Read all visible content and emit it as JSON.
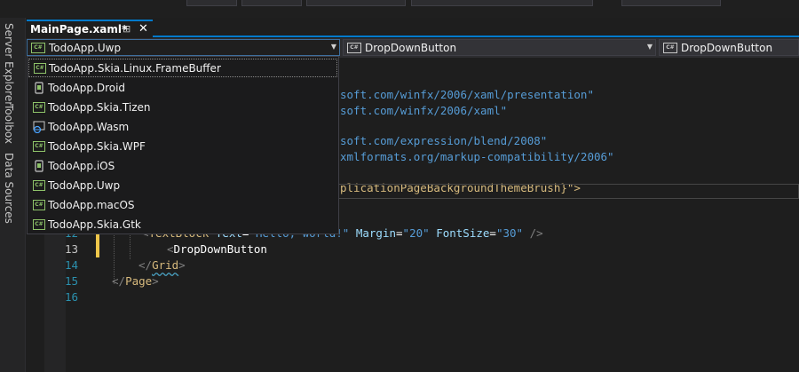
{
  "side_tabs": [
    "Server Explorer",
    "Toolbox",
    "Data Sources"
  ],
  "document_tab": {
    "title": "MainPage.xaml*",
    "pin_icon": "pin-icon",
    "close_icon": "close-icon"
  },
  "navbar": {
    "project": {
      "label": "TodoApp.Uwp",
      "icon": "csharp-project-icon"
    },
    "type": {
      "label": "DropDownButton",
      "icon": "class-icon"
    },
    "member": {
      "label": "DropDownButton",
      "icon": "class-icon"
    }
  },
  "dropdown_items": [
    {
      "label": "TodoApp.Skia.Linux.FrameBuffer",
      "icon": "csharp-project-icon",
      "selected": true
    },
    {
      "label": "TodoApp.Droid",
      "icon": "android-project-icon"
    },
    {
      "label": "TodoApp.Skia.Tizen",
      "icon": "csharp-project-icon"
    },
    {
      "label": "TodoApp.Wasm",
      "icon": "web-project-icon"
    },
    {
      "label": "TodoApp.Skia.WPF",
      "icon": "csharp-project-icon"
    },
    {
      "label": "TodoApp.iOS",
      "icon": "ios-project-icon"
    },
    {
      "label": "TodoApp.Uwp",
      "icon": "csharp-project-icon"
    },
    {
      "label": "TodoApp.macOS",
      "icon": "csharp-project-icon"
    },
    {
      "label": "TodoApp.Skia.Gtk",
      "icon": "csharp-project-icon"
    }
  ],
  "code": {
    "visible_fragments": [
      "soft.com/winfx/2006/xaml/presentation\"",
      "soft.com/winfx/2006/xaml\"",
      "soft.com/expression/blend/2008\"",
      "xmlformats.org/markup-compatibility/2006\"",
      "plicationPageBackgroundThemeBrush}\">"
    ],
    "line12": {
      "number": "12",
      "open": "<",
      "tag": "TextBlock",
      "text_attr": "Text",
      "eq": "=",
      "text_val": "\"Hello, world!\"",
      "margin_attr": "Margin",
      "margin_val": "\"20\"",
      "font_attr": "FontSize",
      "font_val": "\"30\"",
      "close": "/>"
    },
    "line13": {
      "number": "13",
      "open": "<",
      "tag": "DropDownButton"
    },
    "line14": {
      "number": "14",
      "open": "</",
      "tag": "Grid",
      "close": ">"
    },
    "line15": {
      "number": "15",
      "open": "</",
      "tag": "Page",
      "close": ">"
    },
    "line16": {
      "number": "16"
    }
  }
}
